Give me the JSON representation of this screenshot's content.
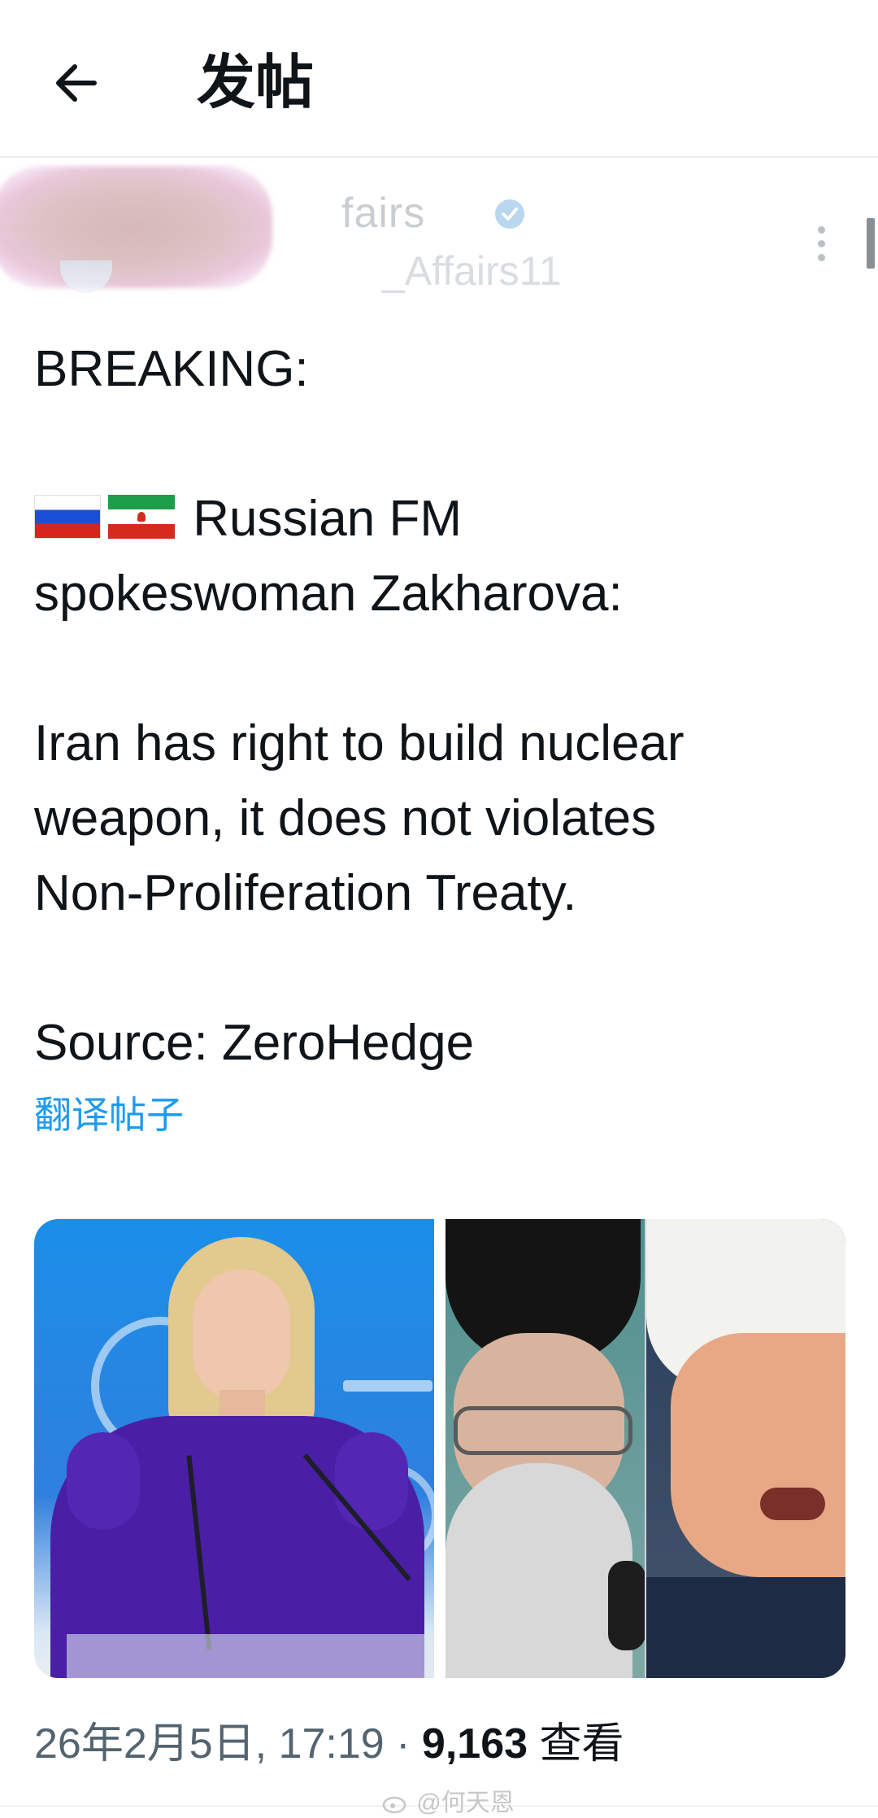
{
  "header": {
    "title": "发帖"
  },
  "author": {
    "display_name": "fairs",
    "handle": "_Affairs11"
  },
  "post": {
    "line1": "BREAKING:",
    "line2_text": "Russian FM",
    "line3": "spokeswoman Zakharova:",
    "line4": "Iran has right to build nuclear",
    "line5": "weapon, it does not violates",
    "line6": "Non-Proliferation Treaty.",
    "line7": "Source: ZeroHedge"
  },
  "translate_label": "翻译帖子",
  "media": {
    "image_count": 3
  },
  "meta": {
    "timestamp": "26年2月5日, 17:19",
    "separator": " · ",
    "views": "9,163",
    "views_label": "查看"
  },
  "watermark": "@何天恩",
  "colors": {
    "link": "#1d9bf0",
    "muted": "#536471",
    "text": "#0f1419"
  }
}
